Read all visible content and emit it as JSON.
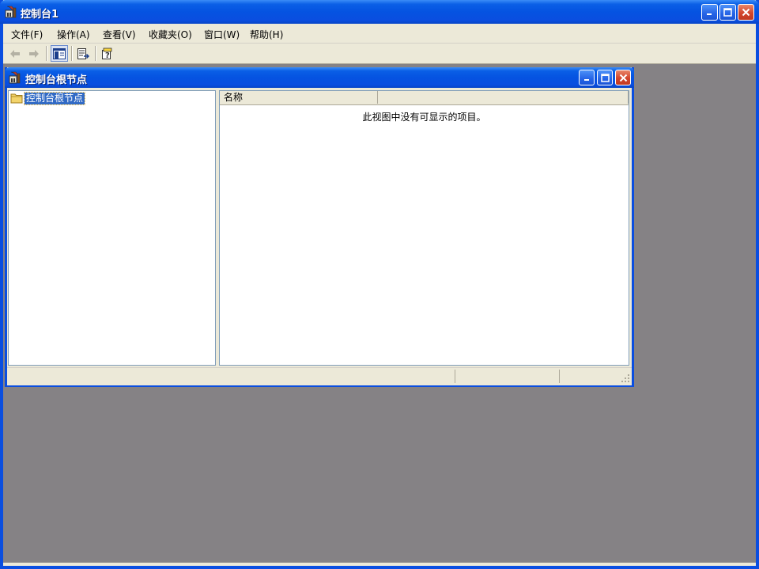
{
  "app": {
    "title": "控制台1",
    "icon": "mmc-console-icon"
  },
  "menubar": {
    "items": [
      {
        "label": "文件(F)"
      },
      {
        "label": "操作(A)"
      },
      {
        "label": "查看(V)"
      },
      {
        "label": "收藏夹(O)"
      },
      {
        "label": "窗口(W)"
      },
      {
        "label": "帮助(H)"
      }
    ]
  },
  "toolbar": {
    "buttons": [
      "back-arrow-icon",
      "forward-arrow-icon",
      "show-hide-tree-icon",
      "export-list-icon",
      "help-icon"
    ]
  },
  "child_window": {
    "title": "控制台根节点",
    "tree": {
      "root_label": "控制台根节点"
    },
    "list": {
      "columns": [
        {
          "label": "名称"
        },
        {
          "label": ""
        }
      ],
      "empty_message": "此视图中没有可显示的项目。"
    }
  },
  "colors": {
    "titlebar_blue": "#0a4ee0",
    "selection_blue": "#316ac5",
    "workspace_gray": "#858285",
    "chrome_beige": "#ece9d8"
  }
}
